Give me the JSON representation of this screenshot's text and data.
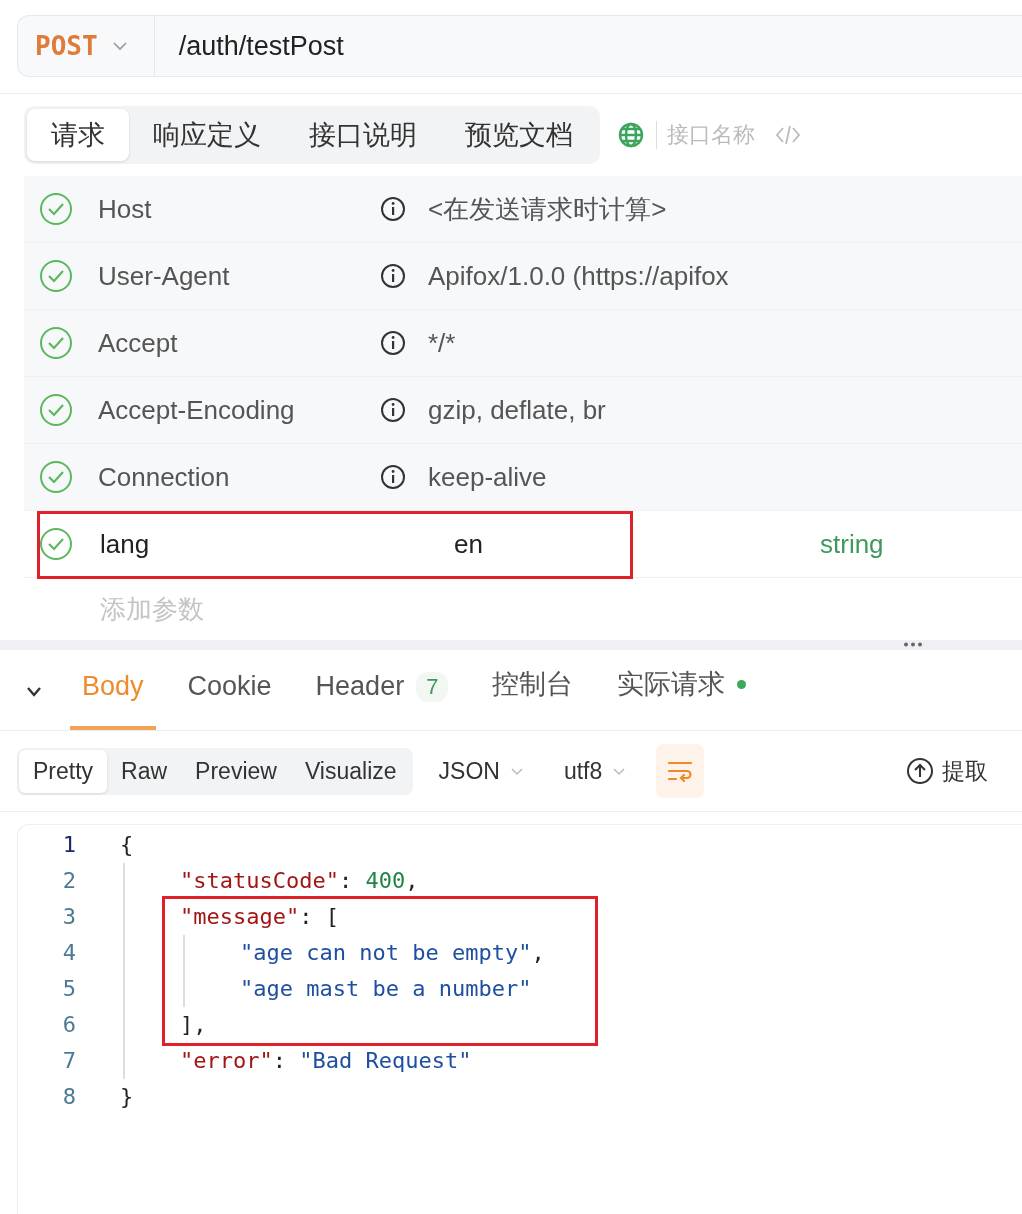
{
  "request_bar": {
    "method": "POST",
    "url": "/auth/testPost"
  },
  "request_tabs": [
    {
      "label": "请求",
      "selected": true
    },
    {
      "label": "响应定义",
      "selected": false
    },
    {
      "label": "接口说明",
      "selected": false
    },
    {
      "label": "预览文档",
      "selected": false
    }
  ],
  "name_field": {
    "placeholder": "接口名称"
  },
  "headers": [
    {
      "kind": "auto",
      "checked": true,
      "name": "Host",
      "value": "<在发送请求时计算>",
      "highlighted": false
    },
    {
      "kind": "auto",
      "checked": true,
      "name": "User-Agent",
      "value": "Apifox/1.0.0 (https://apifox",
      "highlighted": false
    },
    {
      "kind": "auto",
      "checked": true,
      "name": "Accept",
      "value": "*/*",
      "highlighted": false
    },
    {
      "kind": "auto",
      "checked": true,
      "name": "Accept-Encoding",
      "value": "gzip, deflate, br",
      "highlighted": false
    },
    {
      "kind": "auto",
      "checked": true,
      "name": "Connection",
      "value": "keep-alive",
      "highlighted": false
    },
    {
      "kind": "custom",
      "checked": true,
      "name": "lang",
      "value": "en",
      "type": "string",
      "highlighted": true
    }
  ],
  "add_param": {
    "placeholder": "添加参数"
  },
  "response_tabs": [
    {
      "label": "Body",
      "selected": true
    },
    {
      "label": "Cookie",
      "selected": false
    },
    {
      "label": "Header",
      "count": "7",
      "selected": false
    },
    {
      "label": "控制台",
      "selected": false
    },
    {
      "label": "实际请求",
      "dot": true,
      "selected": false
    }
  ],
  "view_modes": [
    {
      "label": "Pretty",
      "selected": true
    },
    {
      "label": "Raw",
      "selected": false
    },
    {
      "label": "Preview",
      "selected": false
    },
    {
      "label": "Visualize",
      "selected": false
    }
  ],
  "format_select": "JSON",
  "encoding_select": "utf8",
  "extract_button": "提取",
  "code": [
    {
      "no": "1",
      "active": true,
      "highlighted": false,
      "tokens": [
        {
          "kind": "punct",
          "text": "{"
        }
      ],
      "children": [
        {
          "no": "2",
          "active": false,
          "highlighted": false,
          "tokens": [
            {
              "kind": "key",
              "text": "\"statusCode\""
            },
            {
              "kind": "punct",
              "text": ": "
            },
            {
              "kind": "number",
              "text": "400"
            },
            {
              "kind": "punct",
              "text": ","
            }
          ]
        },
        {
          "no": "3",
          "active": false,
          "highlighted": true,
          "tokens": [
            {
              "kind": "key",
              "text": "\"message\""
            },
            {
              "kind": "punct",
              "text": ": ["
            }
          ],
          "children": [
            {
              "no": "4",
              "active": false,
              "highlighted": true,
              "tokens": [
                {
                  "kind": "string",
                  "text": "\"age can not be empty\""
                },
                {
                  "kind": "punct",
                  "text": ","
                }
              ]
            },
            {
              "no": "5",
              "active": false,
              "highlighted": true,
              "tokens": [
                {
                  "kind": "string",
                  "text": "\"age mast be a number\""
                }
              ]
            }
          ]
        },
        {
          "no": "6",
          "active": false,
          "highlighted": true,
          "tokens": [
            {
              "kind": "punct",
              "text": "],"
            }
          ]
        },
        {
          "no": "7",
          "active": false,
          "highlighted": false,
          "tokens": [
            {
              "kind": "key",
              "text": "\"error\""
            },
            {
              "kind": "punct",
              "text": ": "
            },
            {
              "kind": "string",
              "text": "\"Bad Request\""
            }
          ]
        }
      ]
    },
    {
      "no": "8",
      "active": false,
      "highlighted": false,
      "tokens": [
        {
          "kind": "punct",
          "text": "}"
        }
      ]
    }
  ]
}
